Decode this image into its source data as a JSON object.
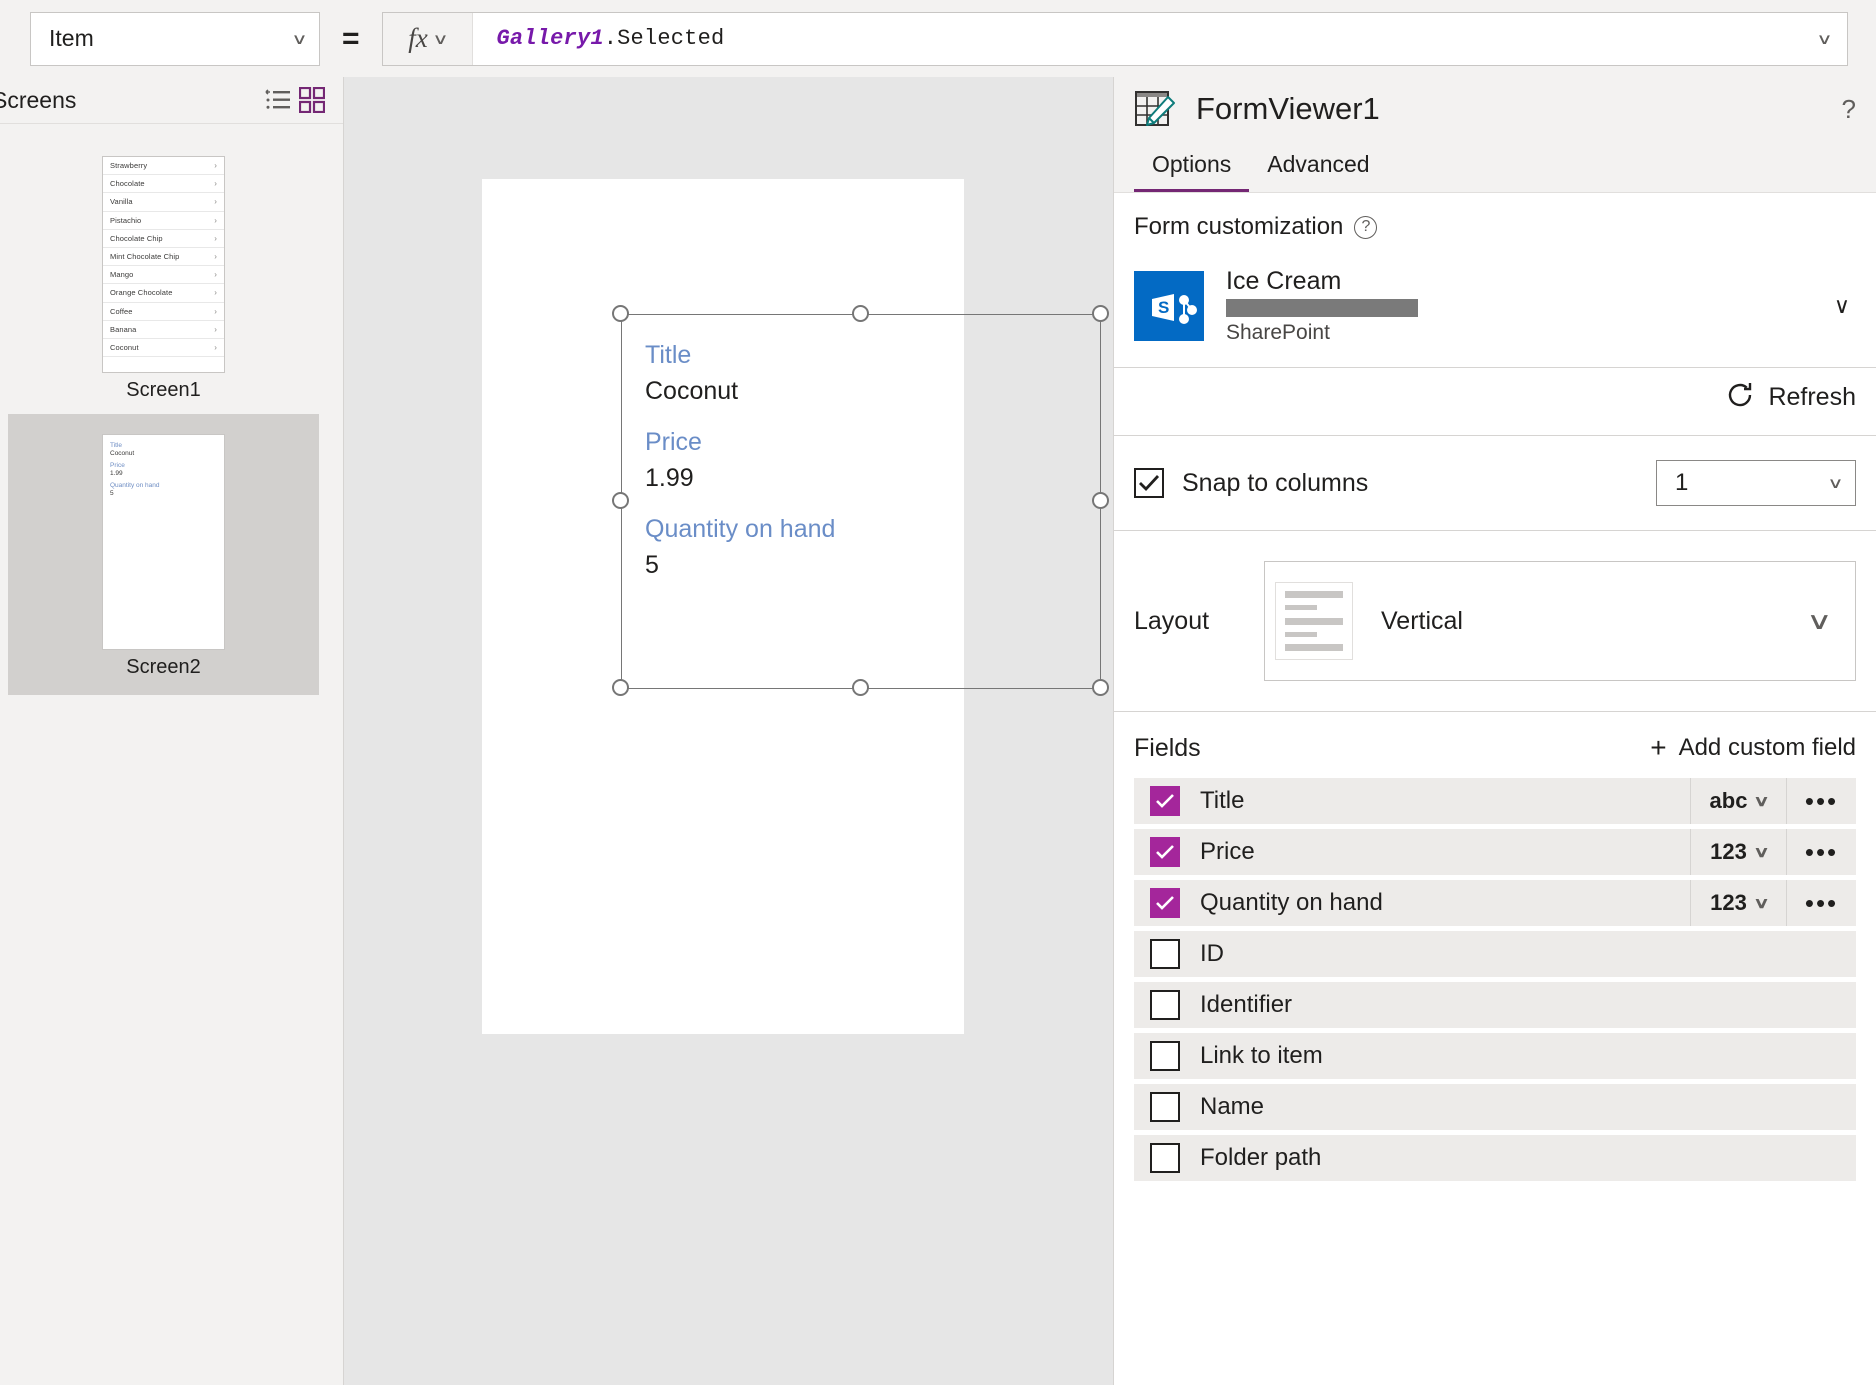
{
  "formula_bar": {
    "property": "Item",
    "equals": "=",
    "fx_label": "fx",
    "formula_identifier": "Gallery1",
    "formula_rest": ".Selected"
  },
  "left_panel": {
    "title": "Screens",
    "view_icons": [
      "tree-view-icon",
      "grid-view-icon"
    ],
    "screens": [
      {
        "label": "Screen1",
        "selected": false,
        "type": "gallery",
        "items": [
          "Strawberry",
          "Chocolate",
          "Vanilla",
          "Pistachio",
          "Chocolate Chip",
          "Mint Chocolate Chip",
          "Mango",
          "Orange Chocolate",
          "Coffee",
          "Banana",
          "Coconut"
        ]
      },
      {
        "label": "Screen2",
        "selected": true,
        "type": "form",
        "fields": [
          {
            "label": "Title",
            "value": "Coconut"
          },
          {
            "label": "Price",
            "value": "1.99"
          },
          {
            "label": "Quantity on hand",
            "value": "5"
          }
        ]
      }
    ]
  },
  "canvas": {
    "form": {
      "fields": [
        {
          "label": "Title",
          "value": "Coconut"
        },
        {
          "label": "Price",
          "value": "1.99"
        },
        {
          "label": "Quantity on hand",
          "value": "5"
        }
      ]
    }
  },
  "right_panel": {
    "title": "FormViewer1",
    "icon": "form-table-pencil-icon",
    "help_glyph": "?",
    "tabs": [
      {
        "label": "Options",
        "active": true
      },
      {
        "label": "Advanced",
        "active": false
      }
    ],
    "form_customization": {
      "heading": "Form customization",
      "data_source": {
        "name": "Ice Cream",
        "account": "",
        "kind": "SharePoint"
      },
      "refresh_label": "Refresh",
      "refresh_icon": "refresh-icon"
    },
    "snap_to_columns": {
      "label": "Snap to columns",
      "checked": true,
      "columns": "1"
    },
    "layout": {
      "label": "Layout",
      "value": "Vertical"
    },
    "fields_section": {
      "title": "Fields",
      "add_label": "Add custom field",
      "rows": [
        {
          "name": "Title",
          "checked": true,
          "type": "abc"
        },
        {
          "name": "Price",
          "checked": true,
          "type": "123"
        },
        {
          "name": "Quantity on hand",
          "checked": true,
          "type": "123"
        },
        {
          "name": "ID",
          "checked": false,
          "type": ""
        },
        {
          "name": "Identifier",
          "checked": false,
          "type": ""
        },
        {
          "name": "Link to item",
          "checked": false,
          "type": ""
        },
        {
          "name": "Name",
          "checked": false,
          "type": ""
        },
        {
          "name": "Folder path",
          "checked": false,
          "type": ""
        }
      ]
    }
  },
  "colors": {
    "accent_purple": "#742774",
    "checkbox_purple": "#a4269b",
    "form_label_blue": "#6a8dc7",
    "sharepoint_blue": "#036ac4",
    "panel_gray": "#f3f2f1",
    "canvas_gray": "#e6e6e6"
  }
}
